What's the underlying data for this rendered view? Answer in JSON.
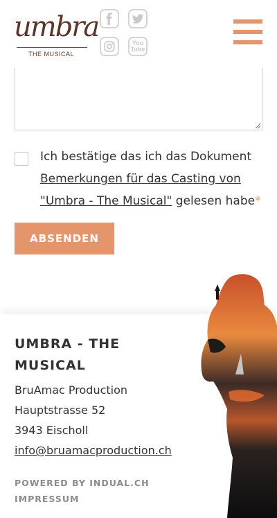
{
  "header": {
    "logo_word": "umbra",
    "logo_sub": "THE MUSICAL",
    "social": {
      "youtube_line1": "You",
      "youtube_line2": "Tube"
    }
  },
  "form": {
    "consent_prefix": "Ich bestätige das ich das Dokument ",
    "consent_link": "Bemerkungen für das Casting von \"Umbra - The Musical\"",
    "consent_suffix": " gelesen habe",
    "required_mark": "*",
    "submit_label": "ABSENDEN"
  },
  "footer": {
    "title": "UMBRA - THE MUSICAL",
    "company": "BruAmac Production",
    "street": "Hauptstrasse 52",
    "city": "3943 Eischoll",
    "email": "info@bruamacproduction.ch",
    "powered_by": "POWERED BY INDUAL.CH",
    "impressum": "IMPRESSUM"
  },
  "colors": {
    "accent": "#e5956c",
    "text": "#333333",
    "brand": "#5a3629"
  }
}
